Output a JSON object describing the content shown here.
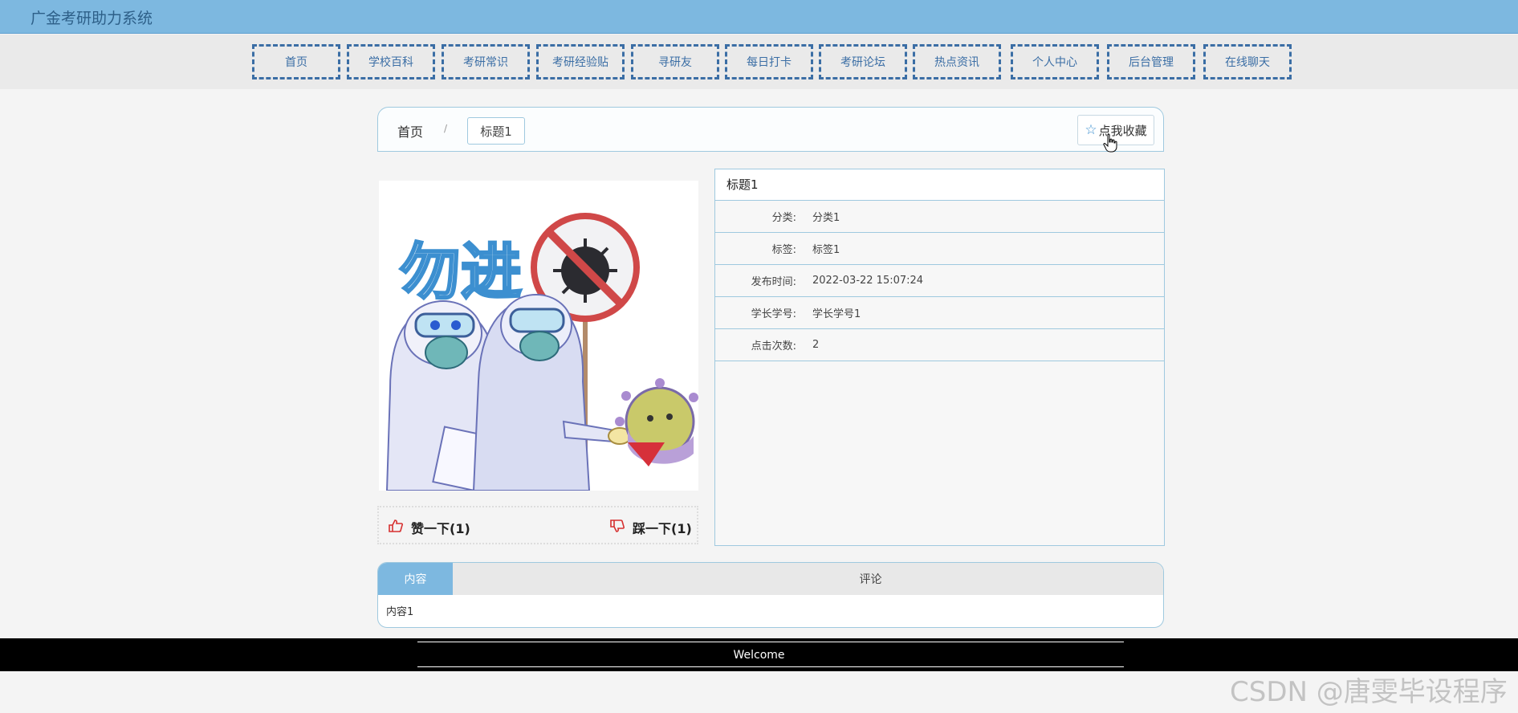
{
  "app": {
    "title": "广金考研助力系统"
  },
  "nav": {
    "items": [
      "首页",
      "学校百科",
      "考研常识",
      "考研经验贴",
      "寻研友",
      "每日打卡",
      "考研论坛",
      "热点资讯",
      "个人中心",
      "后台管理",
      "在线聊天"
    ]
  },
  "breadcrumb": {
    "home": "首页",
    "separator": "/",
    "current": "标题1"
  },
  "favorite": {
    "label": "点我收藏",
    "icon": "star-icon"
  },
  "poster": {
    "text": "勿进"
  },
  "votes": {
    "like": "赞一下(1)",
    "dislike": "踩一下(1)",
    "like_icon": "thumbs-up-icon",
    "dislike_icon": "thumbs-down-icon"
  },
  "detail": {
    "title": "标题1",
    "rows": [
      {
        "label": "分类:",
        "value": "分类1"
      },
      {
        "label": "标签:",
        "value": "标签1"
      },
      {
        "label": "发布时间:",
        "value": "2022-03-22 15:07:24"
      },
      {
        "label": "学长学号:",
        "value": "学长学号1"
      },
      {
        "label": "点击次数:",
        "value": "2"
      }
    ]
  },
  "tabs": {
    "items": [
      "内容",
      "评论"
    ],
    "active": "内容",
    "content": "内容1"
  },
  "footer": {
    "text": "Welcome"
  },
  "watermark": {
    "text": "CSDN @唐雯毕设程序"
  },
  "colors": {
    "header": "#7db8e0",
    "nav_border": "#3b6ea5",
    "accent_red": "#d63030"
  }
}
